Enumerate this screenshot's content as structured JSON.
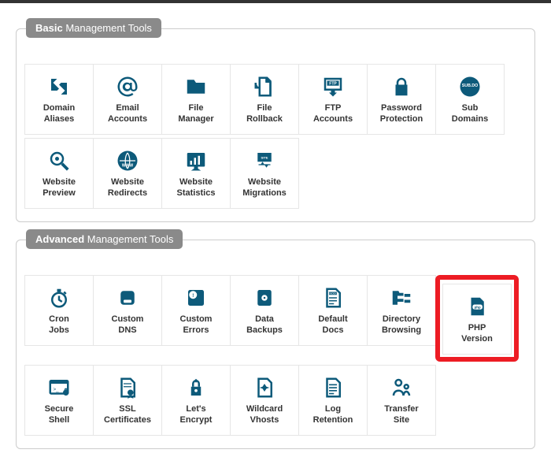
{
  "sections": {
    "basic": {
      "title_bold": "Basic",
      "title_light": "Management Tools",
      "tools": [
        {
          "icon": "domain-aliases",
          "label": "Domain Aliases"
        },
        {
          "icon": "email",
          "label": "Email\nAccounts"
        },
        {
          "icon": "folder",
          "label": "File\nManager"
        },
        {
          "icon": "rollback",
          "label": "File\nRollback"
        },
        {
          "icon": "ftp",
          "label": "FTP\nAccounts"
        },
        {
          "icon": "lock",
          "label": "Password\nProtection"
        },
        {
          "icon": "subdomain",
          "label": "Sub\nDomains"
        },
        {
          "icon": "preview",
          "label": "Website\nPreview"
        },
        {
          "icon": "redirects",
          "label": "Website\nRedirects"
        },
        {
          "icon": "stats",
          "label": "Website\nStatistics"
        },
        {
          "icon": "migrations",
          "label": "Website\nMigrations"
        }
      ]
    },
    "advanced": {
      "title_bold": "Advanced",
      "title_light": "Management Tools",
      "tools": [
        {
          "icon": "cron",
          "label": "Cron\nJobs",
          "highlight": false
        },
        {
          "icon": "dns",
          "label": "Custom\nDNS",
          "highlight": false
        },
        {
          "icon": "errors",
          "label": "Custom\nErrors",
          "highlight": false
        },
        {
          "icon": "backups",
          "label": "Data\nBackups",
          "highlight": false
        },
        {
          "icon": "defaultdocs",
          "label": "Default\nDocs",
          "highlight": false
        },
        {
          "icon": "dirbrowse",
          "label": "Directory\nBrowsing",
          "highlight": false
        },
        {
          "icon": "php",
          "label": "PHP\nVersion",
          "highlight": true
        },
        {
          "icon": "shell",
          "label": "Secure\nShell",
          "highlight": false
        },
        {
          "icon": "ssl",
          "label": "SSL\nCertificates",
          "highlight": false
        },
        {
          "icon": "letsencrypt",
          "label": "Let's\nEncrypt",
          "highlight": false
        },
        {
          "icon": "wildcard",
          "label": "Wildcard\nVhosts",
          "highlight": false
        },
        {
          "icon": "log",
          "label": "Log\nRetention",
          "highlight": false
        },
        {
          "icon": "transfer",
          "label": "Transfer\nSite",
          "highlight": false
        }
      ]
    }
  }
}
